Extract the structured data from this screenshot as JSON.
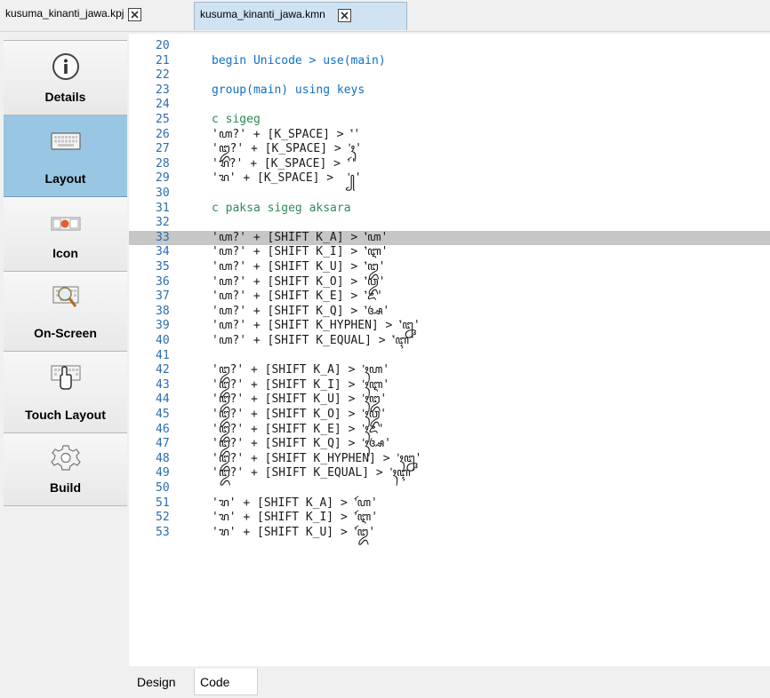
{
  "tabs": [
    {
      "label": "kusuma_kinanti_jawa.kpj",
      "active": false
    },
    {
      "label": "kusuma_kinanti_jawa.kmn",
      "active": true
    }
  ],
  "sidebar": {
    "items": [
      {
        "label": "Details",
        "icon": "info-icon",
        "active": false
      },
      {
        "label": "Layout",
        "icon": "keyboard-icon",
        "active": true
      },
      {
        "label": "Icon",
        "icon": "keyboard-icon-preview",
        "active": false
      },
      {
        "label": "On-Screen",
        "icon": "magnifier-keyboard-icon",
        "active": false
      },
      {
        "label": "Touch Layout",
        "icon": "touch-keyboard-icon",
        "active": false
      },
      {
        "label": "Build",
        "icon": "gear-icon",
        "active": false
      }
    ]
  },
  "editor": {
    "lines": [
      {
        "n": "20",
        "text": "",
        "cls": ""
      },
      {
        "n": "21",
        "text": "begin Unicode > use(main)",
        "cls": "kw"
      },
      {
        "n": "22",
        "text": "",
        "cls": ""
      },
      {
        "n": "23",
        "text": "group(main) using keys",
        "cls": "kw"
      },
      {
        "n": "24",
        "text": "",
        "cls": ""
      },
      {
        "n": "25",
        "text": "c sigeg",
        "cls": "cm"
      },
      {
        "n": "26",
        "text": "'ꦲ?' + [K_SPACE] > 'ꦁ'",
        "cls": ""
      },
      {
        "n": "27",
        "text": "'ꦈ?' + [K_SPACE] > 'ꦃ'",
        "cls": ""
      },
      {
        "n": "28",
        "text": "'ꦫ?' + [K_SPACE] > 'ꦂ'",
        "cls": ""
      },
      {
        "n": "29",
        "text": "'ꦫ' + [K_SPACE] >  '꧀'",
        "cls": ""
      },
      {
        "n": "30",
        "text": "",
        "cls": ""
      },
      {
        "n": "31",
        "text": "c paksa sigeg aksara",
        "cls": "cm"
      },
      {
        "n": "32",
        "text": "",
        "cls": ""
      },
      {
        "n": "33",
        "text": "'ꦲ?' + [SHIFT K_A] > 'ꦁꦲ'",
        "cls": ""
      },
      {
        "n": "34",
        "text": "'ꦲ?' + [SHIFT K_I] > 'ꦁꦆ'",
        "cls": ""
      },
      {
        "n": "35",
        "text": "'ꦲ?' + [SHIFT K_U] > 'ꦁꦈ'",
        "cls": ""
      },
      {
        "n": "36",
        "text": "'ꦲ?' + [SHIFT K_O] > 'ꦁꦎ'",
        "cls": ""
      },
      {
        "n": "37",
        "text": "'ꦲ?' + [SHIFT K_E] > 'ꦁꦌ'",
        "cls": ""
      },
      {
        "n": "38",
        "text": "'ꦲ?' + [SHIFT K_Q] > 'ꦁꦄ'",
        "cls": ""
      },
      {
        "n": "39",
        "text": "'ꦲ?' + [SHIFT K_HYPHEN] > 'ꦁꦋ'",
        "cls": ""
      },
      {
        "n": "40",
        "text": "'ꦲ?' + [SHIFT K_EQUAL] > 'ꦁꦇ'",
        "cls": ""
      },
      {
        "n": "41",
        "text": "",
        "cls": ""
      },
      {
        "n": "42",
        "text": "'ꦈ?' + [SHIFT K_A] > 'ꦃꦲ'",
        "cls": ""
      },
      {
        "n": "43",
        "text": "'ꦈ?' + [SHIFT K_I] > 'ꦃꦆ'",
        "cls": ""
      },
      {
        "n": "44",
        "text": "'ꦈ?' + [SHIFT K_U] > 'ꦃꦈ'",
        "cls": ""
      },
      {
        "n": "45",
        "text": "'ꦈ?' + [SHIFT K_O] > 'ꦃꦎ'",
        "cls": ""
      },
      {
        "n": "46",
        "text": "'ꦈ?' + [SHIFT K_E] > 'ꦃꦌ'",
        "cls": ""
      },
      {
        "n": "47",
        "text": "'ꦈ?' + [SHIFT K_Q] > 'ꦃꦄ'",
        "cls": ""
      },
      {
        "n": "48",
        "text": "'ꦈ?' + [SHIFT K_HYPHEN] > 'ꦃꦋ'",
        "cls": ""
      },
      {
        "n": "49",
        "text": "'ꦈ?' + [SHIFT K_EQUAL] > 'ꦃꦇ'",
        "cls": ""
      },
      {
        "n": "50",
        "text": "",
        "cls": ""
      },
      {
        "n": "51",
        "text": "'ꦫ' + [SHIFT K_A] > 'ꦂꦲ'",
        "cls": ""
      },
      {
        "n": "52",
        "text": "'ꦫ' + [SHIFT K_I] > 'ꦂꦆ'",
        "cls": ""
      },
      {
        "n": "53",
        "text": "'ꦫ' + [SHIFT K_U] > 'ꦂꦈ'",
        "cls": ""
      }
    ],
    "current_line": 33
  },
  "viewtabs": {
    "design": "Design",
    "code": "Code"
  },
  "colors": {
    "accent": "#99c6e3",
    "linenumber": "#2b6cb0",
    "keyword": "#0f6fc6",
    "comment": "#2e8b57"
  }
}
